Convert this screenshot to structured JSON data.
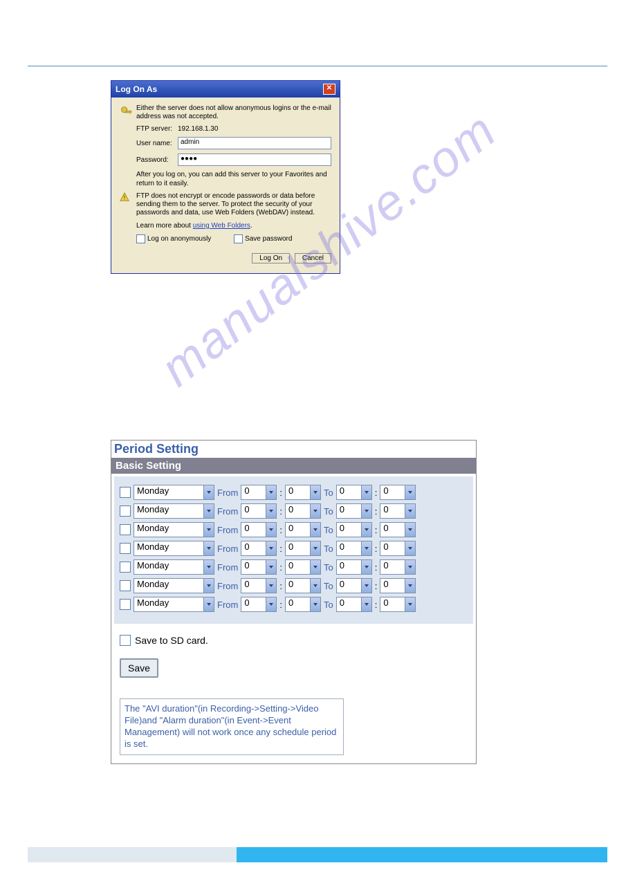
{
  "watermark": "manualshive.com",
  "logon": {
    "title": "Log On As",
    "message": "Either the server does not allow anonymous logins or the e-mail address was not accepted.",
    "ftp_label": "FTP server:",
    "ftp_value": "192.168.1.30",
    "user_label": "User name:",
    "user_value": "admin",
    "password_label": "Password:",
    "password_value": "●●●●",
    "after_text": "After you log on, you can add this server to your Favorites and return to it easily.",
    "warn_text": "FTP does not encrypt or encode passwords or data before sending them to the server. To protect the security of your passwords and data, use Web Folders (WebDAV) instead.",
    "learn_prefix": "Learn more about ",
    "learn_link": "using Web Folders",
    "anon_label": "Log on anonymously",
    "save_pw_label": "Save password",
    "logon_btn": "Log On",
    "cancel_btn": "Cancel"
  },
  "period": {
    "title": "Period Setting",
    "subtitle": "Basic Setting",
    "from_label": "From",
    "to_label": "To",
    "rows": [
      {
        "day": "Monday",
        "fh": "0",
        "fm": "0",
        "th": "0",
        "tm": "0"
      },
      {
        "day": "Monday",
        "fh": "0",
        "fm": "0",
        "th": "0",
        "tm": "0"
      },
      {
        "day": "Monday",
        "fh": "0",
        "fm": "0",
        "th": "0",
        "tm": "0"
      },
      {
        "day": "Monday",
        "fh": "0",
        "fm": "0",
        "th": "0",
        "tm": "0"
      },
      {
        "day": "Monday",
        "fh": "0",
        "fm": "0",
        "th": "0",
        "tm": "0"
      },
      {
        "day": "Monday",
        "fh": "0",
        "fm": "0",
        "th": "0",
        "tm": "0"
      },
      {
        "day": "Monday",
        "fh": "0",
        "fm": "0",
        "th": "0",
        "tm": "0"
      }
    ],
    "sd_label": "Save to SD card.",
    "save_btn": "Save",
    "note": "The \"AVI duration\"(in Recording->Setting->Video File)and \"Alarm duration\"(in Event->Event Management) will not work once any schedule period is set."
  }
}
